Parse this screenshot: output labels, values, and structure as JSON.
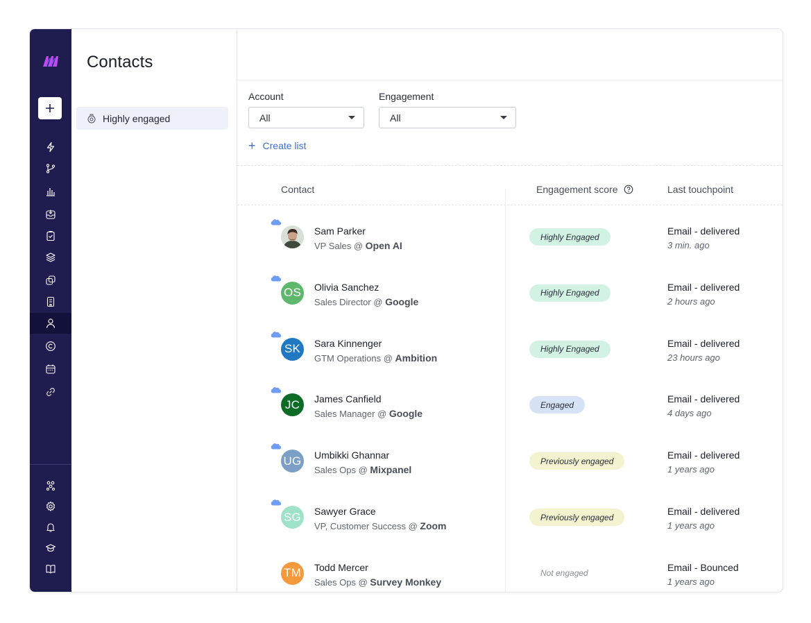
{
  "page": {
    "title": "Contacts"
  },
  "subnav": {
    "items": [
      {
        "label": "Highly engaged",
        "icon": "list-badge-icon"
      }
    ]
  },
  "rail": {
    "icons": [
      "lightning-icon",
      "branch-icon",
      "bar-chart-icon",
      "inbox-icon",
      "clipboard-check-icon",
      "layers-icon",
      "copy-icon",
      "building-icon",
      "person-icon",
      "copyright-icon",
      "calendar-icon",
      "link-icon"
    ],
    "bottom_icons": [
      "org-chart-icon",
      "settings-icon",
      "bell-icon",
      "graduation-cap-icon",
      "book-icon"
    ],
    "active": "person-icon"
  },
  "filters": {
    "account": {
      "label": "Account",
      "value": "All"
    },
    "engagement": {
      "label": "Engagement",
      "value": "All"
    }
  },
  "create_list": {
    "label": "Create list"
  },
  "table": {
    "columns": {
      "contact": "Contact",
      "score": "Engagement score",
      "touchpoint": "Last touchpoint"
    },
    "rows": [
      {
        "name": "Sam Parker",
        "role": "VP Sales",
        "company": "Open AI",
        "initials": "",
        "avatar_color": "#3b4a3a",
        "score": "Highly Engaged",
        "score_bg": "#d2f2e4",
        "touch": "Email - delivered",
        "when": "3 min. ago",
        "crm": true
      },
      {
        "name": "Olivia Sanchez",
        "role": "Sales Director",
        "company": "Google",
        "initials": "OS",
        "avatar_color": "#5db86b",
        "score": "Highly Engaged",
        "score_bg": "#d2f2e4",
        "touch": "Email - delivered",
        "when": "2 hours ago",
        "crm": true
      },
      {
        "name": "Sara Kinnenger",
        "role": "GTM Operations",
        "company": "Ambition",
        "initials": "SK",
        "avatar_color": "#1f78c1",
        "score": "Highly Engaged",
        "score_bg": "#d2f2e4",
        "touch": "Email - delivered",
        "when": "23 hours ago",
        "crm": true
      },
      {
        "name": "James Canfield",
        "role": "Sales Manager",
        "company": "Google",
        "initials": "JC",
        "avatar_color": "#0d6b28",
        "score": "Engaged",
        "score_bg": "#d6e3f6",
        "touch": "Email - delivered",
        "when": "4 days ago",
        "crm": true
      },
      {
        "name": "Umbikki Ghannar",
        "role": "Sales Ops",
        "company": "Mixpanel",
        "initials": "UG",
        "avatar_color": "#7b9fc6",
        "score": "Previously engaged",
        "score_bg": "#f3f3cf",
        "touch": "Email - delivered",
        "when": "1 years ago",
        "crm": true
      },
      {
        "name": "Sawyer Grace",
        "role": "VP, Customer Success",
        "company": "Zoom",
        "initials": "SG",
        "avatar_color": "#9ee3c9",
        "score": "Previously engaged",
        "score_bg": "#f3f3cf",
        "touch": "Email - delivered",
        "when": "1 years ago",
        "crm": true
      },
      {
        "name": "Todd Mercer",
        "role": "Sales Ops",
        "company": "Survey Monkey",
        "initials": "TM",
        "avatar_color": "#f59a3c",
        "score": "Not engaged",
        "score_bg": "",
        "touch": "Email - Bounced",
        "when": "1 years ago",
        "crm": false
      }
    ]
  },
  "colors": {
    "rail": "#1f1d4f",
    "accent": "#3d6fd1",
    "logo": "#c04bf2"
  }
}
